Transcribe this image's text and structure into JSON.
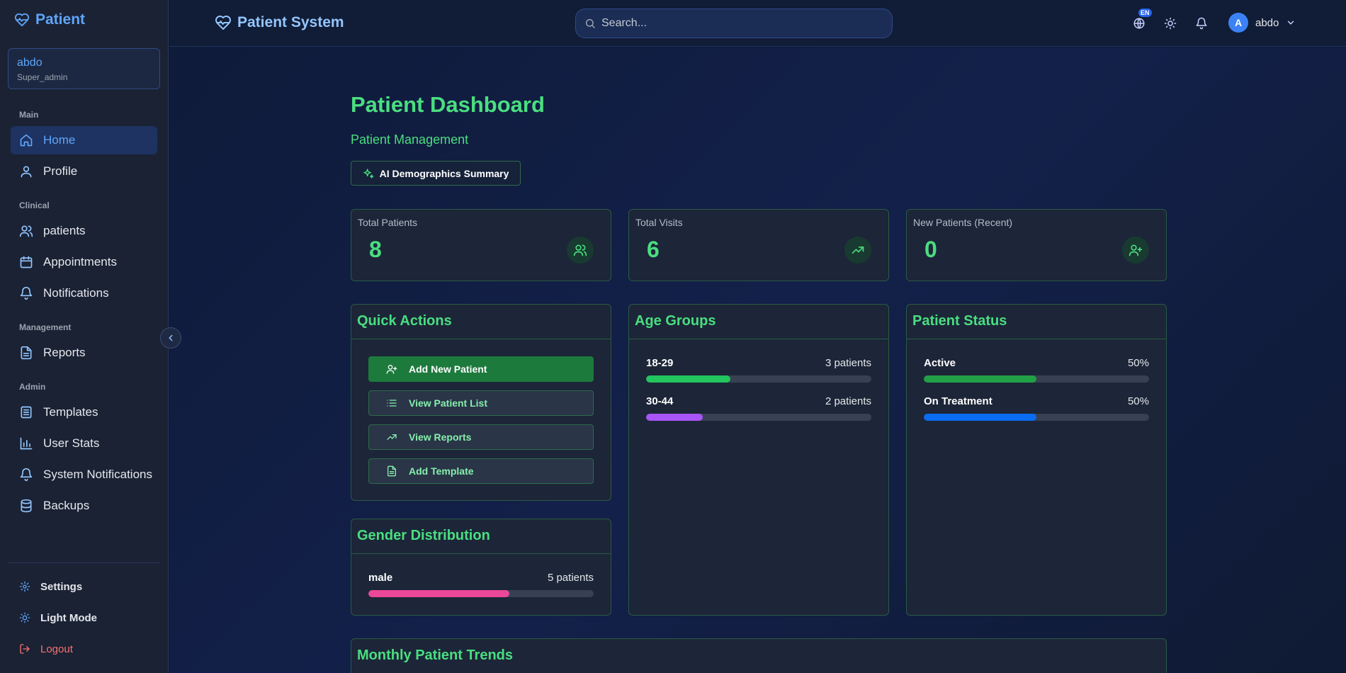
{
  "sidebar": {
    "brand": "Patient",
    "user": {
      "name": "abdo",
      "role": "Super_admin"
    },
    "sections": {
      "main": "Main",
      "clinical": "Clinical",
      "management": "Management",
      "admin": "Admin"
    },
    "items": {
      "home": "Home",
      "profile": "Profile",
      "patients": "patients",
      "appointments": "Appointments",
      "notifications": "Notifications",
      "reports": "Reports",
      "templates": "Templates",
      "user_stats": "User Stats",
      "system_notifications": "System Notifications",
      "backups": "Backups"
    },
    "bottom": {
      "settings": "Settings",
      "light_mode": "Light Mode",
      "logout": "Logout"
    }
  },
  "header": {
    "title": "Patient System",
    "search_placeholder": "Search...",
    "lang_badge": "EN",
    "user_initial": "A",
    "user_name": "abdo"
  },
  "page": {
    "title": "Patient Dashboard",
    "subtitle": "Patient Management",
    "ai_button": "AI Demographics Summary"
  },
  "stats": {
    "total_patients": {
      "label": "Total Patients",
      "value": "8"
    },
    "total_visits": {
      "label": "Total Visits",
      "value": "6"
    },
    "new_patients": {
      "label": "New Patients (Recent)",
      "value": "0"
    }
  },
  "quick_actions": {
    "title": "Quick Actions",
    "add_patient": "Add New Patient",
    "view_list": "View Patient List",
    "view_reports": "View Reports",
    "add_template": "Add Template"
  },
  "age_groups": {
    "title": "Age Groups",
    "rows": [
      {
        "name": "18-29",
        "value_label": "3 patients",
        "fraction": 0.375,
        "color": "#22c55e"
      },
      {
        "name": "30-44",
        "value_label": "2 patients",
        "fraction": 0.25,
        "color": "#a855f7"
      }
    ]
  },
  "patient_status": {
    "title": "Patient Status",
    "rows": [
      {
        "name": "Active",
        "value_label": "50%",
        "fraction": 0.5,
        "color": "#22a046"
      },
      {
        "name": "On Treatment",
        "value_label": "50%",
        "fraction": 0.5,
        "color": "#0a6cf0"
      }
    ]
  },
  "gender": {
    "title": "Gender Distribution",
    "rows": [
      {
        "name": "male",
        "value_label": "5 patients",
        "fraction": 0.625,
        "color": "#ec4899"
      }
    ]
  },
  "monthly_trends": {
    "title": "Monthly Patient Trends"
  }
}
